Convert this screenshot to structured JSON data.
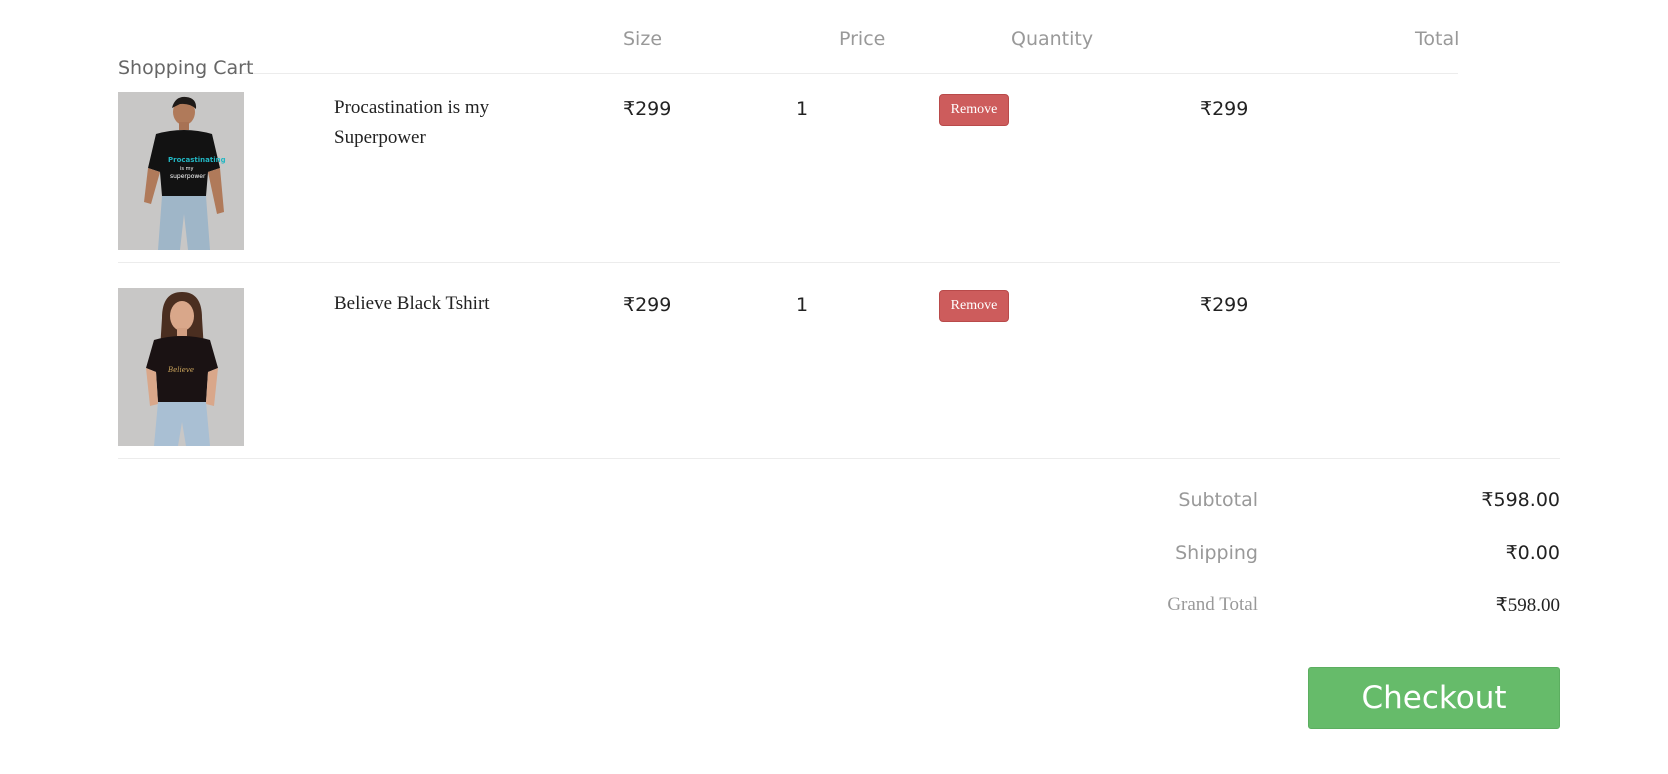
{
  "cart": {
    "title": "Shopping Cart",
    "columns": {
      "size": "Size",
      "price": "Price",
      "quantity": "Quantity",
      "total": "Total"
    },
    "items": [
      {
        "name": "Procastination is my Superpower",
        "price": "₹299",
        "quantity": "1",
        "remove_label": "Remove",
        "total": "₹299",
        "image_icon": "man-black-tshirt-photo"
      },
      {
        "name": "Believe Black Tshirt",
        "price": "₹299",
        "quantity": "1",
        "remove_label": "Remove",
        "total": "₹299",
        "image_icon": "woman-black-tshirt-photo"
      }
    ]
  },
  "summary": {
    "subtotal_label": "Subtotal",
    "subtotal_value": "₹598.00",
    "shipping_label": "Shipping",
    "shipping_value": "₹0.00",
    "grand_total_label": "Grand Total",
    "grand_total_value": "₹598.00"
  },
  "checkout": {
    "label": "Checkout"
  },
  "colors": {
    "remove_button": "#cd5c5c",
    "checkout_button": "#66bb6a",
    "muted_text": "#999999",
    "divider": "#ececec"
  }
}
